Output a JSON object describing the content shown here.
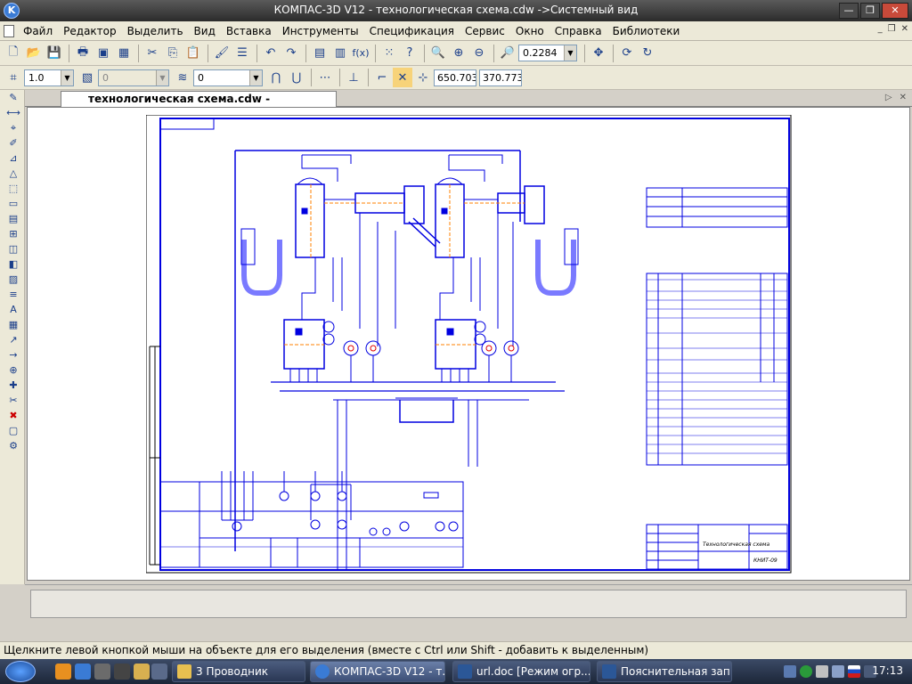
{
  "window": {
    "title": "КОМПАС-3D V12 - технологическая схема.cdw ->Системный вид",
    "app_icon": "K"
  },
  "menu": {
    "items": [
      "Файл",
      "Редактор",
      "Выделить",
      "Вид",
      "Вставка",
      "Инструменты",
      "Спецификация",
      "Сервис",
      "Окно",
      "Справка",
      "Библиотеки"
    ]
  },
  "toolbar1": {
    "zoom_value": "0.2284"
  },
  "toolbar2": {
    "line_scale": "1.0",
    "layer_value": "0",
    "style_value": "0",
    "coord_x": "650.703",
    "coord_y": "370.773"
  },
  "document": {
    "tab_label": "технологическая схема.cdw ->Системный вид"
  },
  "status": {
    "hint": "Щелкните левой кнопкой мыши на объекте для его выделения (вместе с Ctrl или Shift - добавить к выделенным)"
  },
  "taskbar": {
    "tasks": [
      {
        "label": "3 Проводник"
      },
      {
        "label": "КОМПАС-3D V12 - т..."
      },
      {
        "label": "url.doc [Режим огр..."
      },
      {
        "label": "Пояснительная зап..."
      }
    ],
    "clock": "17:13"
  },
  "drawing": {
    "stamp_title": "Технологическая схема",
    "stamp_code": "КНИТ-09"
  },
  "colors": {
    "drawing_line": "#0000e0",
    "accent_orange": "#ff8000",
    "accent_red": "#e00000"
  }
}
